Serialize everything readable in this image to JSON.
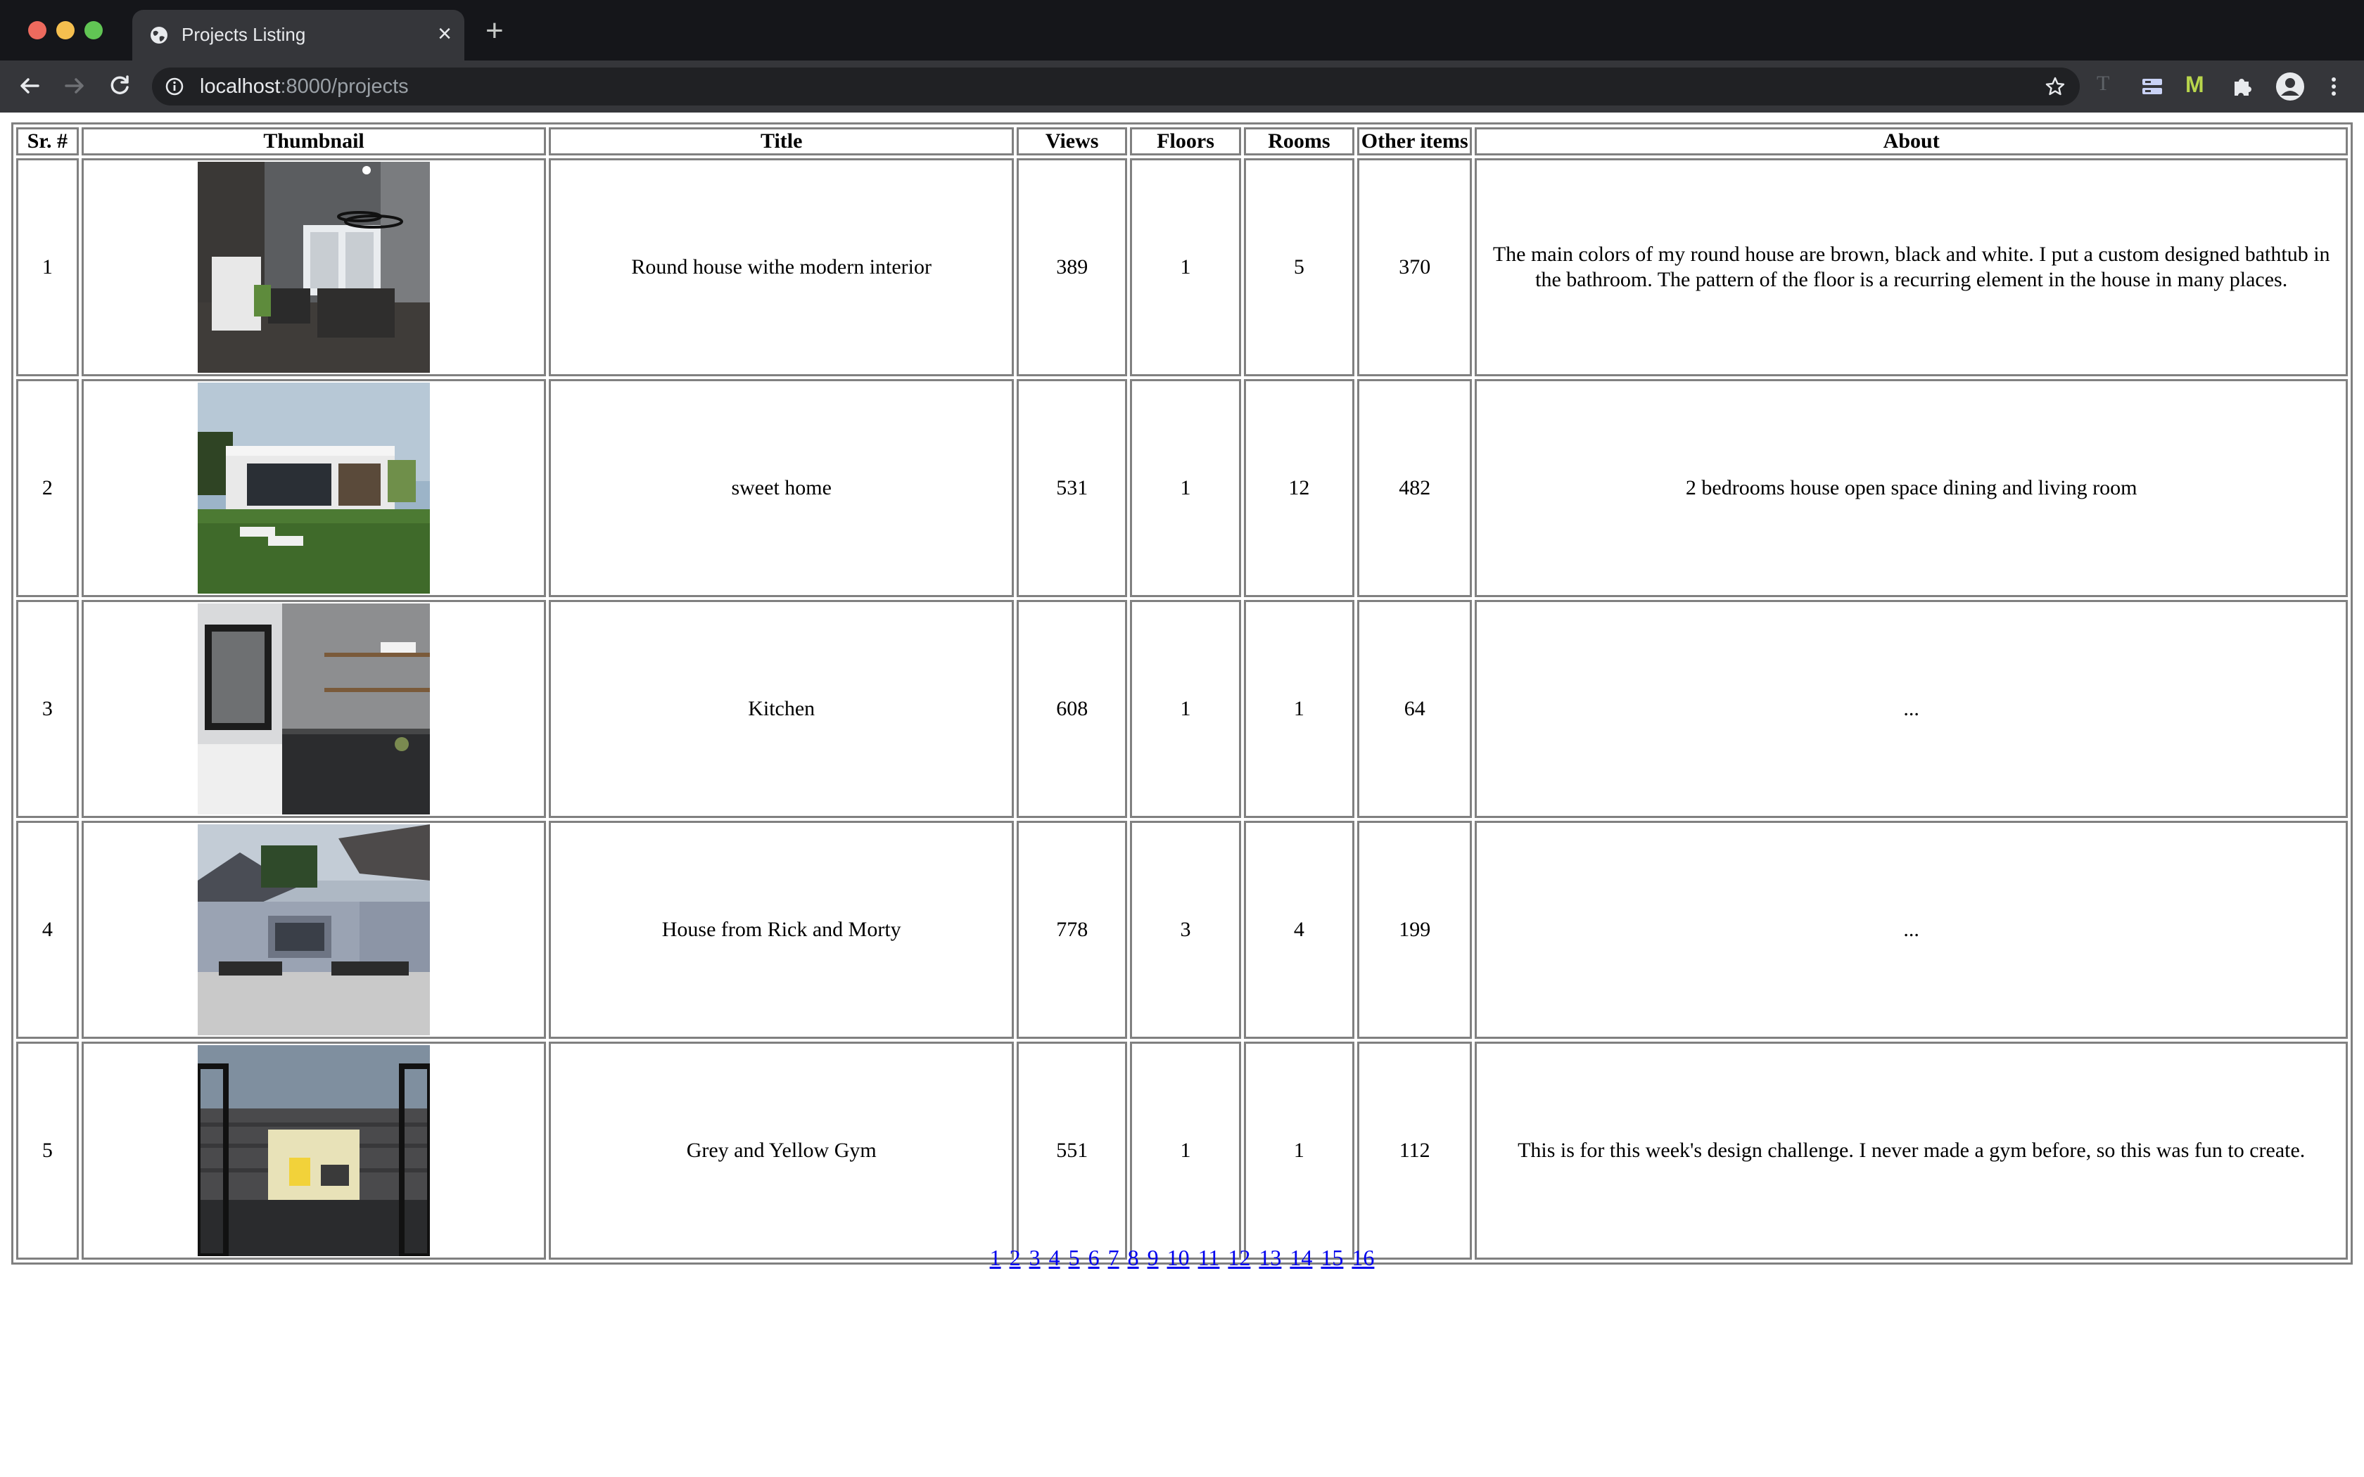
{
  "browser": {
    "tab_title": "Projects Listing",
    "tab_close": "×",
    "new_tab": "+",
    "url_host": "localhost",
    "url_rest": ":8000/projects",
    "ext_t_label": "T",
    "ext_m_label": "M"
  },
  "table": {
    "headers": [
      "Sr. #",
      "Thumbnail",
      "Title",
      "Views",
      "Floors",
      "Rooms",
      "Other items",
      "About"
    ],
    "rows": [
      {
        "sr": "1",
        "thumbnail": "modern-interior-living-room",
        "title": "Round house withe modern interior",
        "views": "389",
        "floors": "1",
        "rooms": "5",
        "other": "370",
        "about": "The main colors of my round house are brown, black and white. I put a custom designed bathtub in the bathroom. The pattern of the floor is a recurring element in the house in many places."
      },
      {
        "sr": "2",
        "thumbnail": "modern-house-exterior-lawn",
        "title": "sweet home",
        "views": "531",
        "floors": "1",
        "rooms": "12",
        "other": "482",
        "about": "2 bedrooms house open space dining and living room"
      },
      {
        "sr": "3",
        "thumbnail": "kitchen-interior",
        "title": "Kitchen",
        "views": "608",
        "floors": "1",
        "rooms": "1",
        "other": "64",
        "about": "..."
      },
      {
        "sr": "4",
        "thumbnail": "house-exterior-driveway",
        "title": "House from Rick and Morty",
        "views": "778",
        "floors": "3",
        "rooms": "4",
        "other": "199",
        "about": "..."
      },
      {
        "sr": "5",
        "thumbnail": "grey-yellow-gym",
        "title": "Grey and Yellow Gym",
        "views": "551",
        "floors": "1",
        "rooms": "1",
        "other": "112",
        "about": "This is for this week's design challenge. I never made a gym before, so this was fun to create."
      }
    ]
  },
  "pagination": [
    "1",
    "2",
    "3",
    "4",
    "5",
    "6",
    "7",
    "8",
    "9",
    "10",
    "11",
    "12",
    "13",
    "14",
    "15",
    "16"
  ]
}
